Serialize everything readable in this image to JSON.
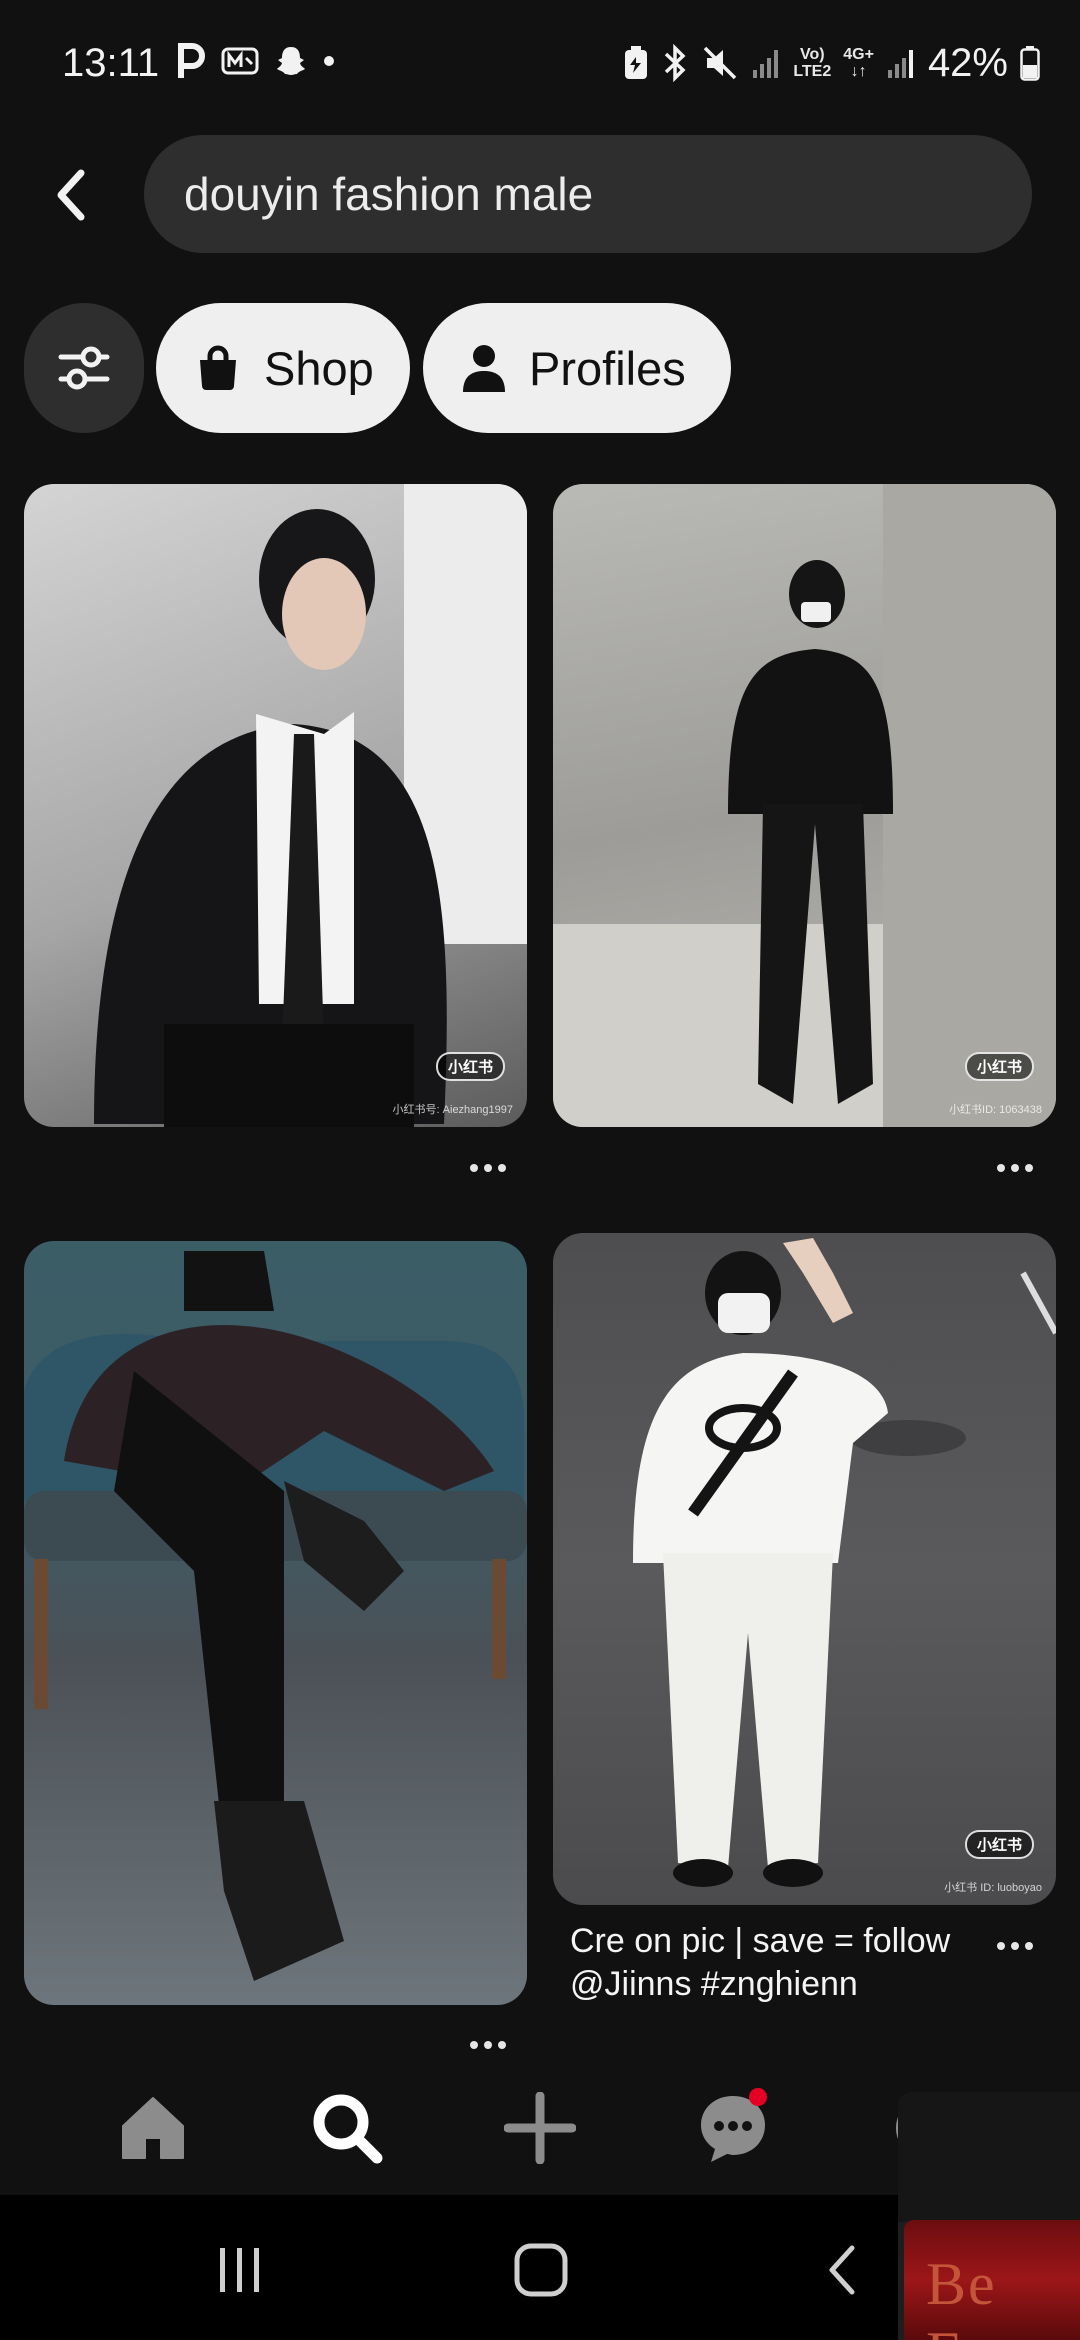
{
  "status_bar": {
    "time": "13:11",
    "battery_percent": "42%",
    "network_label_1_top": "Vo)",
    "network_label_1_bottom": "LTE2",
    "network_label_2_top": "4G+",
    "network_label_2_bottom": "↓↑",
    "left_icons": [
      "p-icon",
      "mnet-icon",
      "snapchat-icon",
      "dot-icon"
    ],
    "right_icons": [
      "battery-saver-icon",
      "bluetooth-icon",
      "mute-icon",
      "signal-icon",
      "signal-icon",
      "battery-icon"
    ]
  },
  "search": {
    "query": "douyin fashion male"
  },
  "filters": {
    "shop_label": "Shop",
    "profiles_label": "Profiles"
  },
  "pins": [
    {
      "watermark": "小红书号: Aiezhang1997",
      "badge": "小红书"
    },
    {
      "watermark": "小红书ID: 1063438",
      "badge": "小红书"
    },
    {
      "watermark": ""
    },
    {
      "watermark": "小红书 ID: luoboyao",
      "badge": "小红书",
      "caption": "Cre on pic | save = follow @Jiinns #znghienn"
    }
  ],
  "bottom_nav": {
    "items": [
      "home-icon",
      "search-icon",
      "create-icon",
      "messages-icon",
      "profile-icon"
    ],
    "accent": "#e60023"
  },
  "pip": {
    "text": "Be Ex"
  },
  "colors": {
    "background": "#111111",
    "chip_background": "#efefef",
    "search_background": "#2e2e2e"
  }
}
